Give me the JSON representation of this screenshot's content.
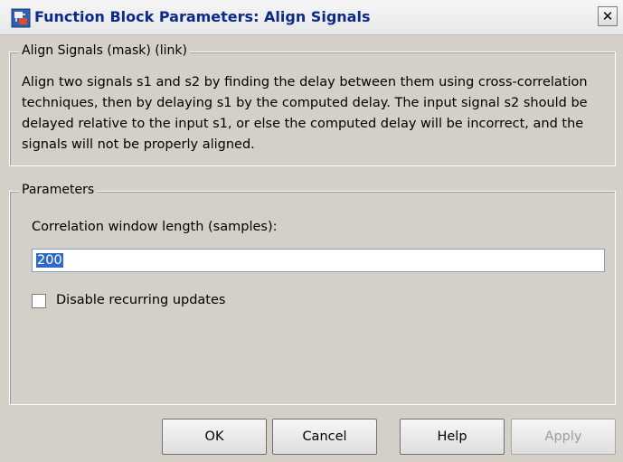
{
  "window": {
    "title": "Function Block Parameters: Align Signals",
    "close_label": "✕"
  },
  "description_group": {
    "title": "Align Signals (mask) (link)",
    "text": "Align two signals s1 and s2 by finding the delay between them using cross-correlation techniques, then by delaying s1 by the computed delay.  The input signal s2 should be delayed relative to the input s1, or else the computed delay will be incorrect, and the signals will not be properly aligned."
  },
  "parameters_group": {
    "title": "Parameters",
    "field_label": "Correlation window length (samples):",
    "field_value": "200",
    "checkbox_label": "Disable recurring updates",
    "checkbox_checked": false
  },
  "buttons": {
    "ok": "OK",
    "cancel": "Cancel",
    "help": "Help",
    "apply": "Apply"
  },
  "colors": {
    "dialog_bg": "#d4d0c8",
    "title_text": "#0b2a8a",
    "selection": "#316ac5"
  },
  "icons": {
    "title_icon": "simulink-block-icon"
  }
}
